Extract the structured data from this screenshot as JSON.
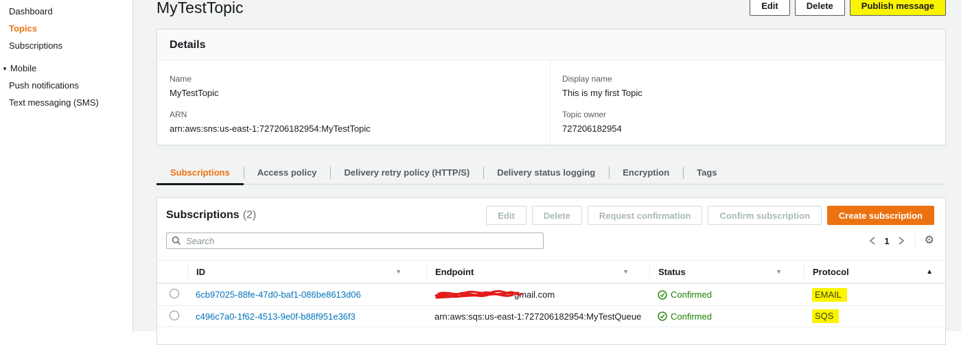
{
  "sidebar": {
    "items": [
      {
        "label": "Dashboard"
      },
      {
        "label": "Topics",
        "active": true
      },
      {
        "label": "Subscriptions"
      }
    ],
    "mobile_section": {
      "label": "Mobile",
      "items": [
        {
          "label": "Push notifications"
        },
        {
          "label": "Text messaging (SMS)"
        }
      ]
    }
  },
  "header": {
    "title": "MyTestTopic",
    "edit_label": "Edit",
    "delete_label": "Delete",
    "publish_label": "Publish message"
  },
  "details": {
    "title": "Details",
    "name_label": "Name",
    "name_value": "MyTestTopic",
    "arn_label": "ARN",
    "arn_value": "arn:aws:sns:us-east-1:727206182954:MyTestTopic",
    "display_name_label": "Display name",
    "display_name_value": "This is my first Topic",
    "topic_owner_label": "Topic owner",
    "topic_owner_value": "727206182954"
  },
  "tabs": [
    {
      "label": "Subscriptions",
      "active": true
    },
    {
      "label": "Access policy"
    },
    {
      "label": "Delivery retry policy (HTTP/S)"
    },
    {
      "label": "Delivery status logging"
    },
    {
      "label": "Encryption"
    },
    {
      "label": "Tags"
    }
  ],
  "subscriptions": {
    "title": "Subscriptions",
    "count": "(2)",
    "actions": {
      "edit": "Edit",
      "delete": "Delete",
      "request_confirmation": "Request confirmation",
      "confirm_subscription": "Confirm subscription",
      "create_subscription": "Create subscription"
    },
    "search": {
      "placeholder": "Search"
    },
    "pagination": {
      "current_page": "1"
    },
    "table": {
      "columns": {
        "id": "ID",
        "endpoint": "Endpoint",
        "status": "Status",
        "protocol": "Protocol"
      },
      "rows": [
        {
          "id": "6cb97025-88fe-47d0-baf1-086be8613d06",
          "endpoint_visible": "gmail.com",
          "endpoint_redacted": true,
          "status": "Confirmed",
          "protocol": "EMAIL"
        },
        {
          "id": "c496c7a0-1f62-4513-9e0f-b88f951e36f3",
          "endpoint_visible": "arn:aws:sqs:us-east-1:727206182954:MyTestQueue",
          "endpoint_redacted": false,
          "status": "Confirmed",
          "protocol": "SQS"
        }
      ]
    }
  },
  "colors": {
    "accent_orange": "#ec7211",
    "link_blue": "#0073bb",
    "status_green": "#1d8102",
    "highlight_yellow": "#fbf400",
    "redaction_red": "#e31b1b"
  }
}
